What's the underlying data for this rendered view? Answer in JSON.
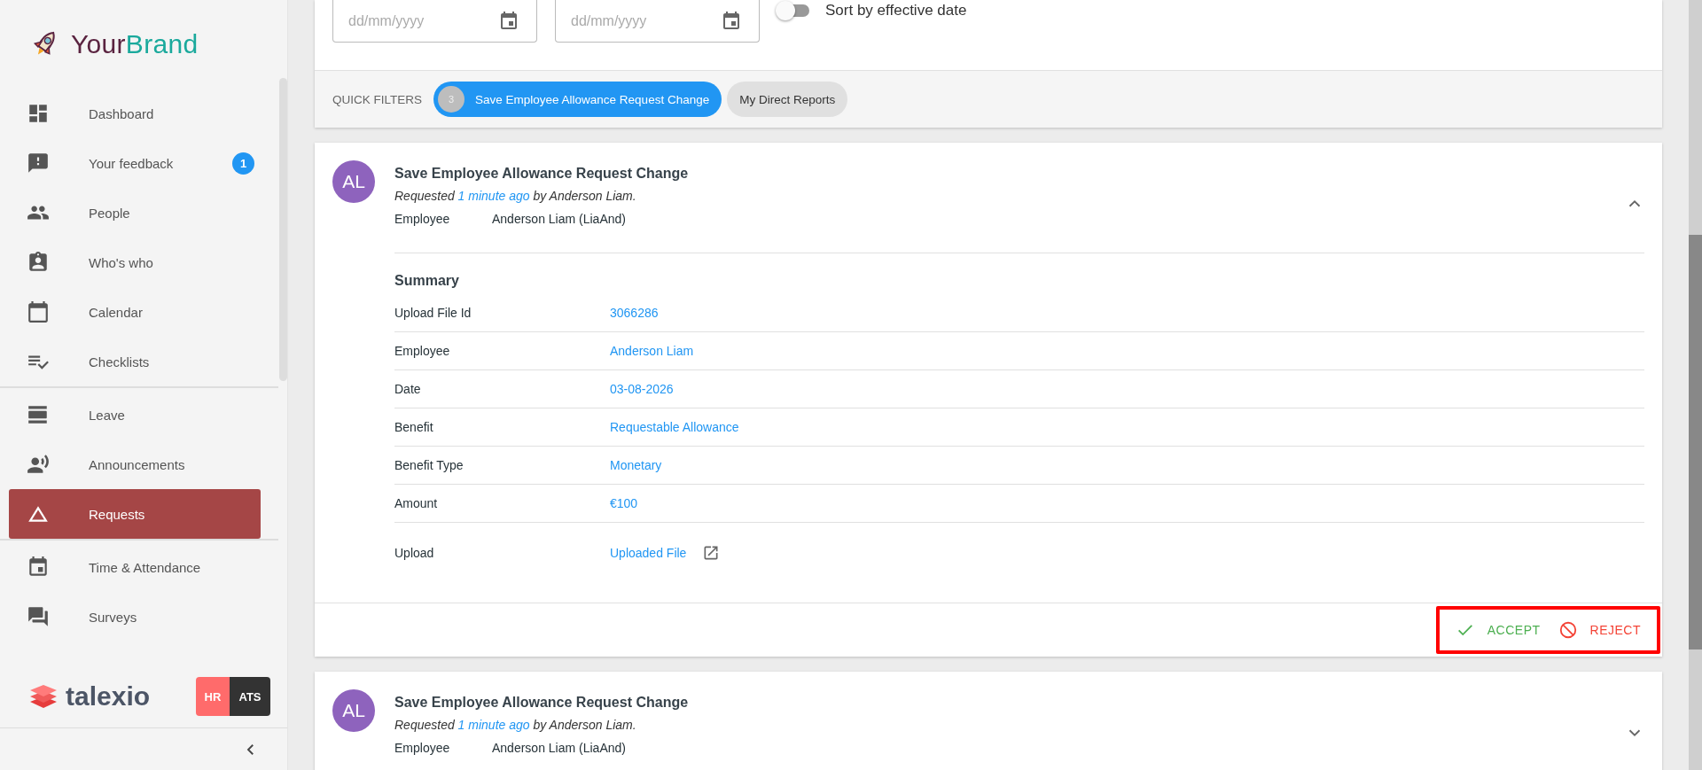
{
  "brand": {
    "first": "Your",
    "second": "Brand"
  },
  "sidebar": {
    "groups": [
      [
        {
          "label": "Dashboard",
          "selected": false
        },
        {
          "label": "Your feedback",
          "selected": false,
          "badge": "1"
        },
        {
          "label": "People",
          "selected": false
        },
        {
          "label": "Who's who",
          "selected": false
        },
        {
          "label": "Calendar",
          "selected": false
        },
        {
          "label": "Checklists",
          "selected": false
        }
      ],
      [
        {
          "label": "Leave",
          "selected": false
        },
        {
          "label": "Announcements",
          "selected": false
        },
        {
          "label": "Requests",
          "selected": true
        }
      ],
      [
        {
          "label": "Time & Attendance",
          "selected": false
        },
        {
          "label": "Surveys",
          "selected": false
        }
      ]
    ],
    "product": "talexio",
    "modules": [
      {
        "label": "HR",
        "selected": true
      },
      {
        "label": "ATS",
        "selected": false
      }
    ]
  },
  "filters": {
    "date_fields": [
      {
        "placeholder": "dd/mm/yyyy"
      },
      {
        "placeholder": "dd/mm/yyyy"
      }
    ],
    "sort_toggle": {
      "label": "Sort by effective date",
      "on": false
    },
    "quick_filters": {
      "label": "QUICK FILTERS",
      "chips": [
        {
          "count": "3",
          "label": "Save Employee Allowance Request Change",
          "selected": true
        },
        {
          "label": "My Direct Reports",
          "selected": false
        }
      ]
    }
  },
  "requests": [
    {
      "initials": "AL",
      "title": "Save Employee Allowance Request Change",
      "requested": {
        "prefix": "Requested",
        "time": "1 minute ago",
        "suffix": "by Anderson Liam."
      },
      "employee": {
        "label": "Employee",
        "value": "Anderson Liam (LiaAnd)"
      },
      "expanded": true,
      "summary": {
        "title": "Summary",
        "rows": [
          {
            "label": "Upload File Id",
            "value": "3066286",
            "kind": "link"
          },
          {
            "label": "Employee",
            "value": "Anderson Liam",
            "kind": "link"
          },
          {
            "label": "Date",
            "value": "03-08-2026",
            "kind": "link"
          },
          {
            "label": "Benefit",
            "value": "Requestable Allowance",
            "kind": "link"
          },
          {
            "label": "Benefit Type",
            "value": "Monetary",
            "kind": "link"
          },
          {
            "label": "Amount",
            "value": "€100",
            "kind": "link"
          },
          {
            "label": "Upload",
            "value": "Uploaded File",
            "kind": "file"
          }
        ]
      },
      "actions": [
        {
          "label": "ACCEPT",
          "kind": "accept"
        },
        {
          "label": "REJECT",
          "kind": "reject"
        }
      ]
    },
    {
      "initials": "AL",
      "title": "Save Employee Allowance Request Change",
      "requested": {
        "prefix": "Requested",
        "time": "1 minute ago",
        "suffix": "by Anderson Liam."
      },
      "employee": {
        "label": "Employee",
        "value": "Anderson Liam (LiaAnd)"
      },
      "expanded": false
    }
  ]
}
